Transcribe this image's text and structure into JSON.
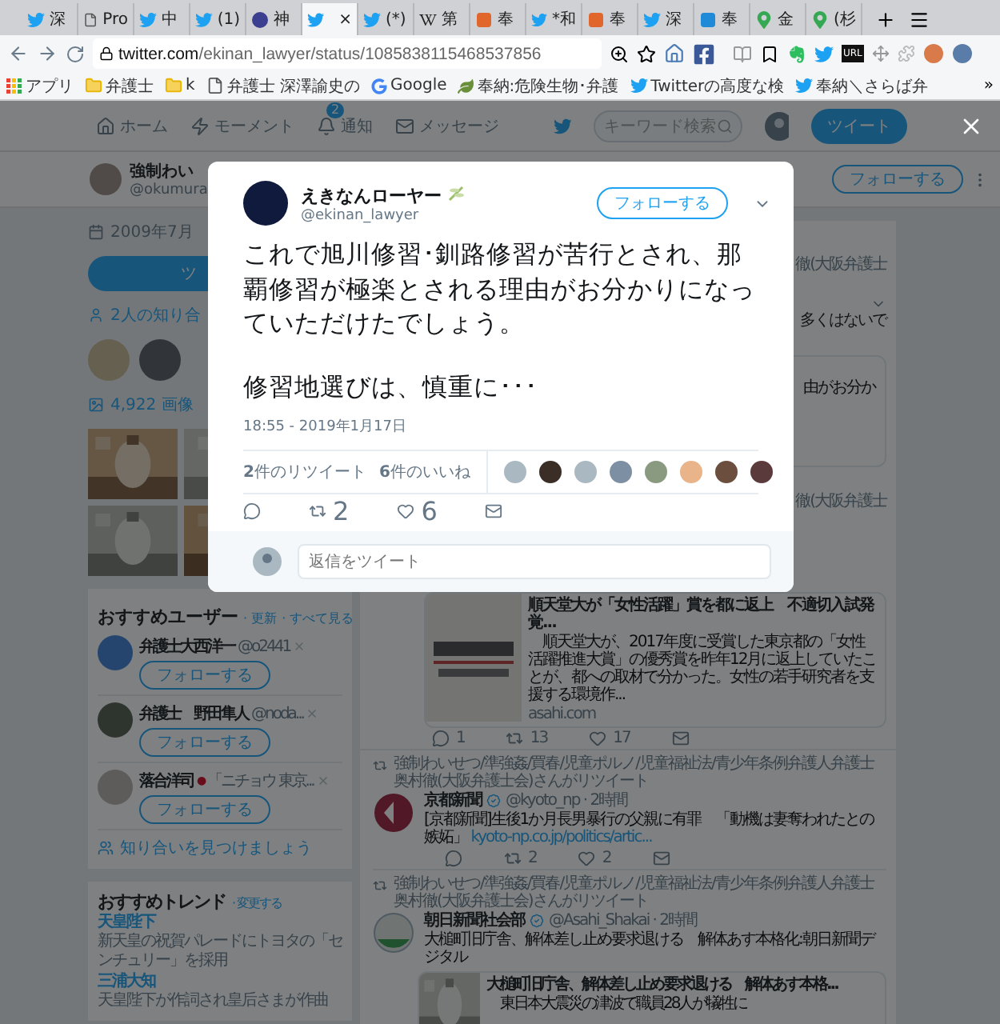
{
  "tabs": [
    {
      "kind": "twitter",
      "label": "深",
      "selected": false
    },
    {
      "kind": "page",
      "label": "Pro",
      "selected": false
    },
    {
      "kind": "twitter",
      "label": "中",
      "selected": false
    },
    {
      "kind": "twitter",
      "label": "(1)",
      "selected": false
    },
    {
      "kind": "logo",
      "label": "神",
      "selected": false
    },
    {
      "kind": "twitter",
      "label": "×",
      "selected": true
    },
    {
      "kind": "twitter",
      "label": "(*)",
      "selected": false
    },
    {
      "kind": "wiki",
      "label": "第",
      "selected": false
    },
    {
      "kind": "orange",
      "label": "奉",
      "selected": false
    },
    {
      "kind": "twitter",
      "label": "*和",
      "selected": false
    },
    {
      "kind": "orange",
      "label": "奉",
      "selected": false
    },
    {
      "kind": "twitter",
      "label": "深",
      "selected": false
    },
    {
      "kind": "tblue",
      "label": "奉",
      "selected": false
    },
    {
      "kind": "maps",
      "label": "金",
      "selected": false
    },
    {
      "kind": "maps",
      "label": "(杉",
      "selected": false
    }
  ],
  "address_bar": {
    "host": "twitter.com",
    "path": "/ekinan_lawyer/status/1085838115468537856",
    "extension_label": "URL"
  },
  "bookmarks": [
    {
      "kind": "apps",
      "label": "アプリ"
    },
    {
      "kind": "folder",
      "label": "弁護士"
    },
    {
      "kind": "folder",
      "label": "k"
    },
    {
      "kind": "page",
      "label": "弁護士 深澤諭史の"
    },
    {
      "kind": "google",
      "label": "Google"
    },
    {
      "kind": "plant",
      "label": "奉納:危険生物･弁護"
    },
    {
      "kind": "twitter",
      "label": "Twitterの高度な検"
    },
    {
      "kind": "twitter",
      "label": "奉納＼さらば弁"
    }
  ],
  "bookmarks_more": "»",
  "nav": {
    "items": [
      {
        "kind": "home",
        "label": "ホーム"
      },
      {
        "kind": "bolt",
        "label": "モーメント"
      },
      {
        "kind": "bell",
        "label": "通知",
        "badge": "2"
      },
      {
        "kind": "mail",
        "label": "メッセージ"
      }
    ],
    "search_placeholder": "キーワード検索",
    "tweet_button": "ツイート"
  },
  "profile": {
    "name": "強制わい",
    "handle": "@okumura",
    "follow": "フォローする"
  },
  "sidebar": {
    "joined": "2009年7月",
    "tweet_button": "ツ",
    "known_followers": "2人の知り合",
    "media": "4,922 画像"
  },
  "who_to_follow": {
    "title": "おすすめユーザー",
    "links": [
      "· 更新",
      "· すべて見る"
    ],
    "users": [
      {
        "name": "弁護士大西洋一",
        "handle": "@o2441",
        "follow": "フォローする"
      },
      {
        "name": "弁護士　野田隼人",
        "handle": "@noda...",
        "follow": "フォローする"
      },
      {
        "name": "落合洋司",
        "mark": "●",
        "handle": "「ニチョウ 東京...",
        "follow": "フォローする"
      }
    ],
    "find": "知り合いを見つけましょう"
  },
  "trends": {
    "title": "おすすめトレンド",
    "link": "· 変更する",
    "items": [
      {
        "name": "天皇陛下",
        "desc": "新天皇の祝賀パレードにトヨタの「センチュリー」を採用"
      },
      {
        "name": "三浦大知",
        "desc": "天皇陛下が作詞され皇后さまが作曲"
      }
    ]
  },
  "timeline_fragments": [
    "徹(大阪弁護士",
    "多くはないで",
    "由がお分か",
    "徹(大阪弁護士"
  ],
  "news_card": {
    "title": "順天堂大が「女性活躍」賞を都に返上　不適切入試発覚...",
    "desc": "　順天堂大が、2017年度に受賞した東京都の「女性活躍推進大賞」の優秀賞を昨年12月に返上していたことが、都への取材で分かった。女性の若手研究者を支援する環境作...",
    "domain": "asahi.com",
    "replies": "1",
    "retweets": "13",
    "likes": "17"
  },
  "tweets": [
    {
      "retweeted_by": "強制わいせつ/準強姦/買春/児童ポルノ/児童福祉法/青少年条例弁護人弁護士奥村徹(大阪弁護士会)さんがリツイート",
      "name": "京都新聞",
      "handle": "@kyoto_np · 2時間",
      "text": "[京都新聞]生後1か月長男暴行の父親に有罪　「動機は妻奪われたとの嫉妬」",
      "link": "kyoto-np.co.jp/politics/artic...",
      "kind": "kyoto",
      "retweets": "2",
      "likes": "2"
    },
    {
      "retweeted_by": "強制わいせつ/準強姦/買春/児童ポルノ/児童福祉法/青少年条例弁護人弁護士奥村徹(大阪弁護士会)さんがリツイート",
      "name": "朝日新聞社会部",
      "handle": "@Asahi_Shakai · 2時間",
      "text": "大槌町旧庁舎、解体差し止め要求退ける　解体あす本格化:朝日新聞デジタル",
      "kind": "asahi",
      "card": {
        "title": "大槌町旧庁舎、解体差し止め要求退ける　解体あす本格...",
        "desc": "　東日本大震災の津波で職員28人が犠牲に"
      }
    }
  ],
  "modal": {
    "name": "えきなんローヤー",
    "handle": "@ekinan_lawyer",
    "follow": "フォローする",
    "paragraphs": [
      "これで旭川修習･釧路修習が苦行とされ、那覇修習が極楽とされる理由がお分かりになっていただけたでしょう。",
      "修習地選びは、慎重に･･･"
    ],
    "time": "18:55 - 2019年1月17日",
    "retweets_label": "**2**件のリツイート",
    "likes_label": "**6**件のいいね",
    "retweets": "2",
    "likes": "6",
    "reply_placeholder": "返信をツイート"
  }
}
